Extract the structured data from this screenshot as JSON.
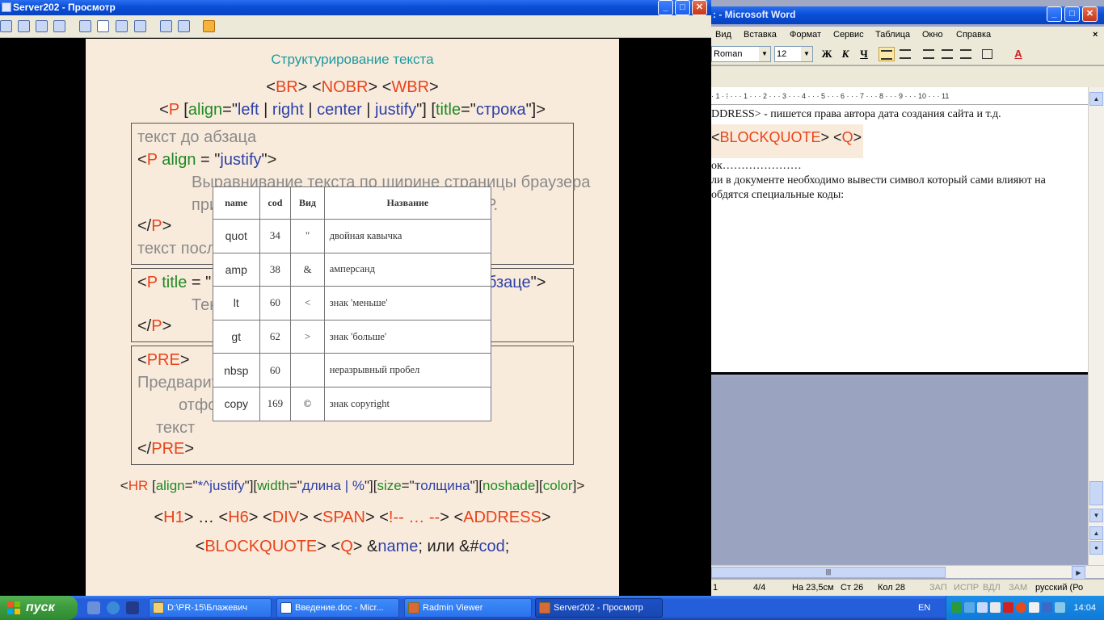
{
  "radmin": {
    "title": "Server202 - Просмотр",
    "controls": {
      "minimize": "_",
      "maximize": "□",
      "close": "✕"
    }
  },
  "slide": {
    "title": "Структурирование текста",
    "line_br": [
      "<",
      "BR",
      "> <",
      "NOBR",
      "> <",
      "WBR",
      ">"
    ],
    "line_p": {
      "open": "<",
      "tag": "P",
      "b1": " [",
      "attr": "align",
      "eq": "=\"",
      "v1": "left",
      "sep1": " | ",
      "v2": "right",
      "sep2": " | ",
      "v3": "center",
      "sep3": " | ",
      "v4": "justify",
      "q": "\"] [",
      "attr2": "title",
      "eq2": "=\"",
      "v5": "строка",
      "end": "\"]>"
    },
    "box1": {
      "l1": "текст до абзаца",
      "l2_a": "<",
      "l2_tag": "P",
      "l2_attr": " align",
      "l2_eq": " = \"",
      "l2_val": "justify",
      "l2_end": "\">",
      "l3": "Выравнивание текста по ширине страницы браузера",
      "l4": "при",
      "l4b": "Р.",
      "l5_a": "</",
      "l5_tag": "P",
      "l5_end": ">",
      "l6": "текст после"
    },
    "box2": {
      "l1_a": "<",
      "l1_tag": "P",
      "l1_attr": " title",
      "l1_eq": " = \"",
      "l1_tail": "бзаце",
      "l1_tail_end": "\">",
      "l2": "Тек",
      "l3_a": "</",
      "l3_tag": "P",
      "l3_end": ">"
    },
    "box3": {
      "l1_a": "<",
      "l1_tag": "PRE",
      "l1_end": ">",
      "l2": "Предварит",
      "l3": "отфо",
      "l4": "текст",
      "l5_a": "</",
      "l5_tag": "PRE",
      "l5_end": ">"
    },
    "line_hr": {
      "a": "<",
      "tag": "HR",
      "b": " [",
      "at1": "align",
      "e1": "=\"",
      "v1": "*^justify",
      "c1": "\"][",
      "at2": "width",
      "e2": "=\"",
      "v2": "длина | %",
      "c2": "\"][",
      "at3": "size",
      "e3": "=\"",
      "v3": "толщина",
      "c3": "\"][",
      "at4": "noshade",
      "c4": "][",
      "at5": "color",
      "c5": "]>"
    },
    "line_h": {
      "a1": "<",
      "t1": "H1",
      "b1": "> … <",
      "t2": "H6",
      "b2": "> <",
      "t3": "DIV",
      "b3": "> <",
      "t4": "SPAN",
      "b4": "> <",
      "t5": "!-- … --",
      "b5": "> <",
      "t6": "ADDRESS",
      "b6": ">"
    },
    "line_bq": {
      "a1": "<",
      "t1": "BLOCKQUOTE",
      "b1": "> <",
      "t2": "Q",
      "b2": ">  &",
      "n": "name",
      "b3": "; или &#",
      "c": "cod",
      "b4": ";"
    }
  },
  "entity_table": {
    "headers": [
      "name",
      "cod",
      "Вид",
      "Название"
    ],
    "rows": [
      [
        "quot",
        "34",
        "\"",
        "двойная кавычка"
      ],
      [
        "amp",
        "38",
        "&",
        "амперсанд"
      ],
      [
        "lt",
        "60",
        "<",
        "знак 'меньше'"
      ],
      [
        "gt",
        "62",
        ">",
        "знак 'больше'"
      ],
      [
        "nbsp",
        "60",
        "",
        "неразрывный пробел"
      ],
      [
        "copy",
        "169",
        "©",
        "знак copyright"
      ]
    ]
  },
  "word": {
    "title": ": - Microsoft Word",
    "menu": [
      "Вид",
      "Вставка",
      "Формат",
      "Сервис",
      "Таблица",
      "Окно",
      "Справка"
    ],
    "font": "Roman",
    "size": "12",
    "btn_bold": "Ж",
    "btn_italic": "К",
    "btn_underline": "Ч",
    "btn_fontcolor": "A",
    "ruler": "· 1 · ⁞ ·  · · 1 · · · 2 · · · 3 · · · 4 · · · 5 · · · 6 · · · 7 · · · 8 · · · 9 · · · 10 · · · 11",
    "doc": {
      "l1": "DDRESS> - пишется права автора дата создания сайта и т.д.",
      "l2_a": "<",
      "l2_t1": "BLOCKQUOTE",
      "l2_b": "> <",
      "l2_t2": "Q",
      "l2_c": ">",
      "l3": "ок…………………",
      "l4": "ли в документе необходимо вывести символ который сами влияют на",
      "l5": "обдятся специальные коды:"
    },
    "status": {
      "page": "1",
      "pages": "4/4",
      "at": "На 23,5см",
      "ln": "Ст 26",
      "col": "Кол 28",
      "rec": "ЗАП",
      "trk": "ИСПР",
      "ext": "ВДЛ",
      "ovr": "ЗАМ",
      "lang": "русский (Ро"
    }
  },
  "taskbar": {
    "start": "пуск",
    "tasks": [
      {
        "label": "D:\\PR-15\\Блажевич",
        "active": false
      },
      {
        "label": "Введение.doc - Micr...",
        "active": false
      },
      {
        "label": "Radmin Viewer",
        "active": false
      },
      {
        "label": "Server202 - Просмотр",
        "active": true
      }
    ],
    "lang": "EN",
    "time": "14:04"
  }
}
